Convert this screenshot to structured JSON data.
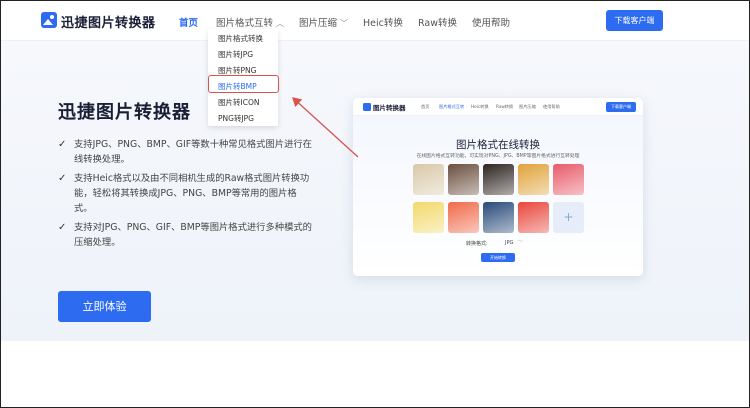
{
  "app": {
    "logo_text": "迅捷图片转换器",
    "download_label": "下载客户端"
  },
  "nav": {
    "items": [
      {
        "label": "首页"
      },
      {
        "label": "图片格式互转"
      },
      {
        "label": "图片压缩"
      },
      {
        "label": "Heic转换"
      },
      {
        "label": "Raw转换"
      },
      {
        "label": "使用帮助"
      }
    ]
  },
  "dropdown": {
    "items": [
      {
        "label": "图片格式转换"
      },
      {
        "label": "图片转JPG"
      },
      {
        "label": "图片转PNG"
      },
      {
        "label": "图片转BMP"
      },
      {
        "label": "图片转ICON"
      },
      {
        "label": "PNG转JPG"
      }
    ],
    "highlighted_index": 3
  },
  "hero": {
    "title": "迅捷图片转换器",
    "features": [
      {
        "text": "支持JPG、PNG、BMP、GIF等数十种常见格式图片进行在线转换处理。"
      },
      {
        "text": "支持Heic格式以及由不同相机生成的Raw格式图片转换功能，轻松将其转换成JPG、PNG、BMP等常用的图片格式。"
      },
      {
        "text": "支持对JPG、PNG、GIF、BMP等图片格式进行多种模式的压缩处理。"
      }
    ],
    "cta_label": "立即体验",
    "check_glyph": "✓"
  },
  "preview": {
    "logo_text": "图片转换器",
    "nav_items": [
      {
        "label": "首页"
      },
      {
        "label": "图片格式互转"
      },
      {
        "label": "Heic转换"
      },
      {
        "label": "Raw转换"
      },
      {
        "label": "图片压缩"
      },
      {
        "label": "使用帮助"
      }
    ],
    "download_label": "下载客户端",
    "title": "图片格式在线转换",
    "subtitle": "在线图片格式互转功能，可实现对PNG、JPG、BMP等图片格式进行互转处理",
    "format_label": "转换格式:",
    "format_value": "JPG",
    "start_label": "开始转换",
    "plus_glyph": "+",
    "thumb_colors": [
      "#d9c8a8",
      "#6b4f3f",
      "#2c2420",
      "#e0a33a",
      "#e85b6a",
      "#f2d96a",
      "#f06a4a",
      "#284a7a",
      "#e8453c"
    ]
  },
  "colors": {
    "accent": "#2d6cf0",
    "highlight_border": "#d9534f"
  }
}
